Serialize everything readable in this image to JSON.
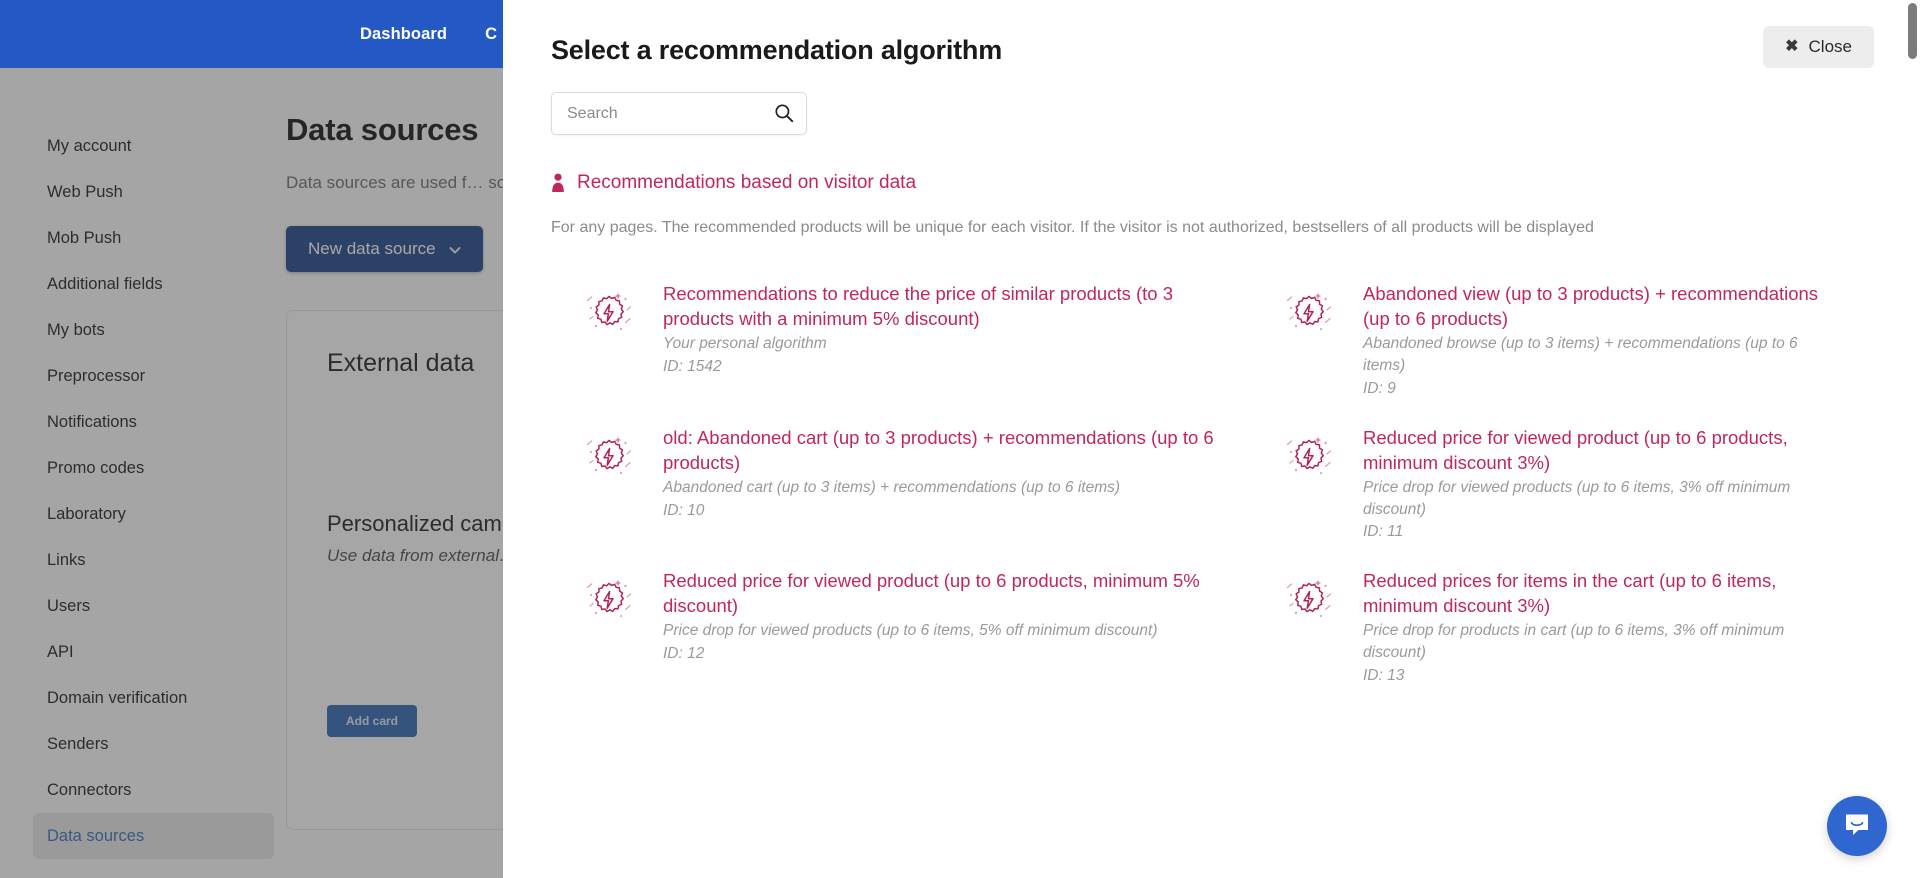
{
  "background": {
    "topnav": {
      "links": [
        "Dashboard",
        "C"
      ]
    },
    "sidebar": {
      "items": [
        {
          "label": "My account",
          "active": false
        },
        {
          "label": "Web Push",
          "active": false
        },
        {
          "label": "Mob Push",
          "active": false
        },
        {
          "label": "Additional fields",
          "active": false
        },
        {
          "label": "My bots",
          "active": false
        },
        {
          "label": "Preprocessor",
          "active": false
        },
        {
          "label": "Notifications",
          "active": false
        },
        {
          "label": "Promo codes",
          "active": false
        },
        {
          "label": "Laboratory",
          "active": false
        },
        {
          "label": "Links",
          "active": false
        },
        {
          "label": "Users",
          "active": false
        },
        {
          "label": "API",
          "active": false
        },
        {
          "label": "Domain verification",
          "active": false
        },
        {
          "label": "Senders",
          "active": false
        },
        {
          "label": "Connectors",
          "active": false
        },
        {
          "label": "Data sources",
          "active": true
        }
      ]
    },
    "content": {
      "page_title": "Data sources",
      "page_subtitle": "Data sources are used f… sources",
      "new_data_source_button": "New data source",
      "card_title": "External data",
      "card_sub_title": "Personalized camp",
      "card_sub_desc": "Use data from external… campaigns",
      "add_card_button": "Add card"
    }
  },
  "modal": {
    "title": "Select a recommendation algorithm",
    "close_label": "Close",
    "search": {
      "placeholder": "Search",
      "value": ""
    },
    "section": {
      "heading": "Recommendations based on visitor data",
      "description": "For any pages. The recommended products will be unique for each visitor. If the visitor is not authorized, bestsellers of all products will be displayed"
    },
    "algorithms": [
      {
        "title": "Recommendations to reduce the price of similar products (to 3 products with a minimum 5% discount)",
        "description": "Your personal algorithm",
        "id_label": "ID: 1542"
      },
      {
        "title": "Abandoned view (up to 3 products) + recommendations (up to 6 products)",
        "description": "Abandoned browse (up to 3 items) + recommendations (up to 6 items)",
        "id_label": "ID: 9"
      },
      {
        "title": "old: Abandoned cart (up to 3 products) + recommendations (up to 6 products)",
        "description": "Abandoned cart (up to 3 items) + recommendations (up to 6 items)",
        "id_label": "ID: 10"
      },
      {
        "title": "Reduced price for viewed product (up to 6 products, minimum discount 3%)",
        "description": "Price drop for viewed products (up to 6 items, 3% off minimum discount)",
        "id_label": "ID: 11"
      },
      {
        "title": "Reduced price for viewed product (up to 6 products, minimum 5% discount)",
        "description": "Price drop for viewed products (up to 6 items, 5% off minimum discount)",
        "id_label": "ID: 12"
      },
      {
        "title": "Reduced prices for items in the cart (up to 6 items, minimum discount 3%)",
        "description": "Price drop for products in cart (up to 6 items, 3% off minimum discount)",
        "id_label": "ID: 13"
      }
    ]
  },
  "widgets": {
    "intercom_launcher": "messenger-icon"
  },
  "colors": {
    "nav_blue": "#2458c4",
    "accent_crimson": "#c2275a",
    "primary_button_blue": "#1d4487",
    "muted_text": "#9a9a9a",
    "intercom_blue": "#2f66cf"
  }
}
